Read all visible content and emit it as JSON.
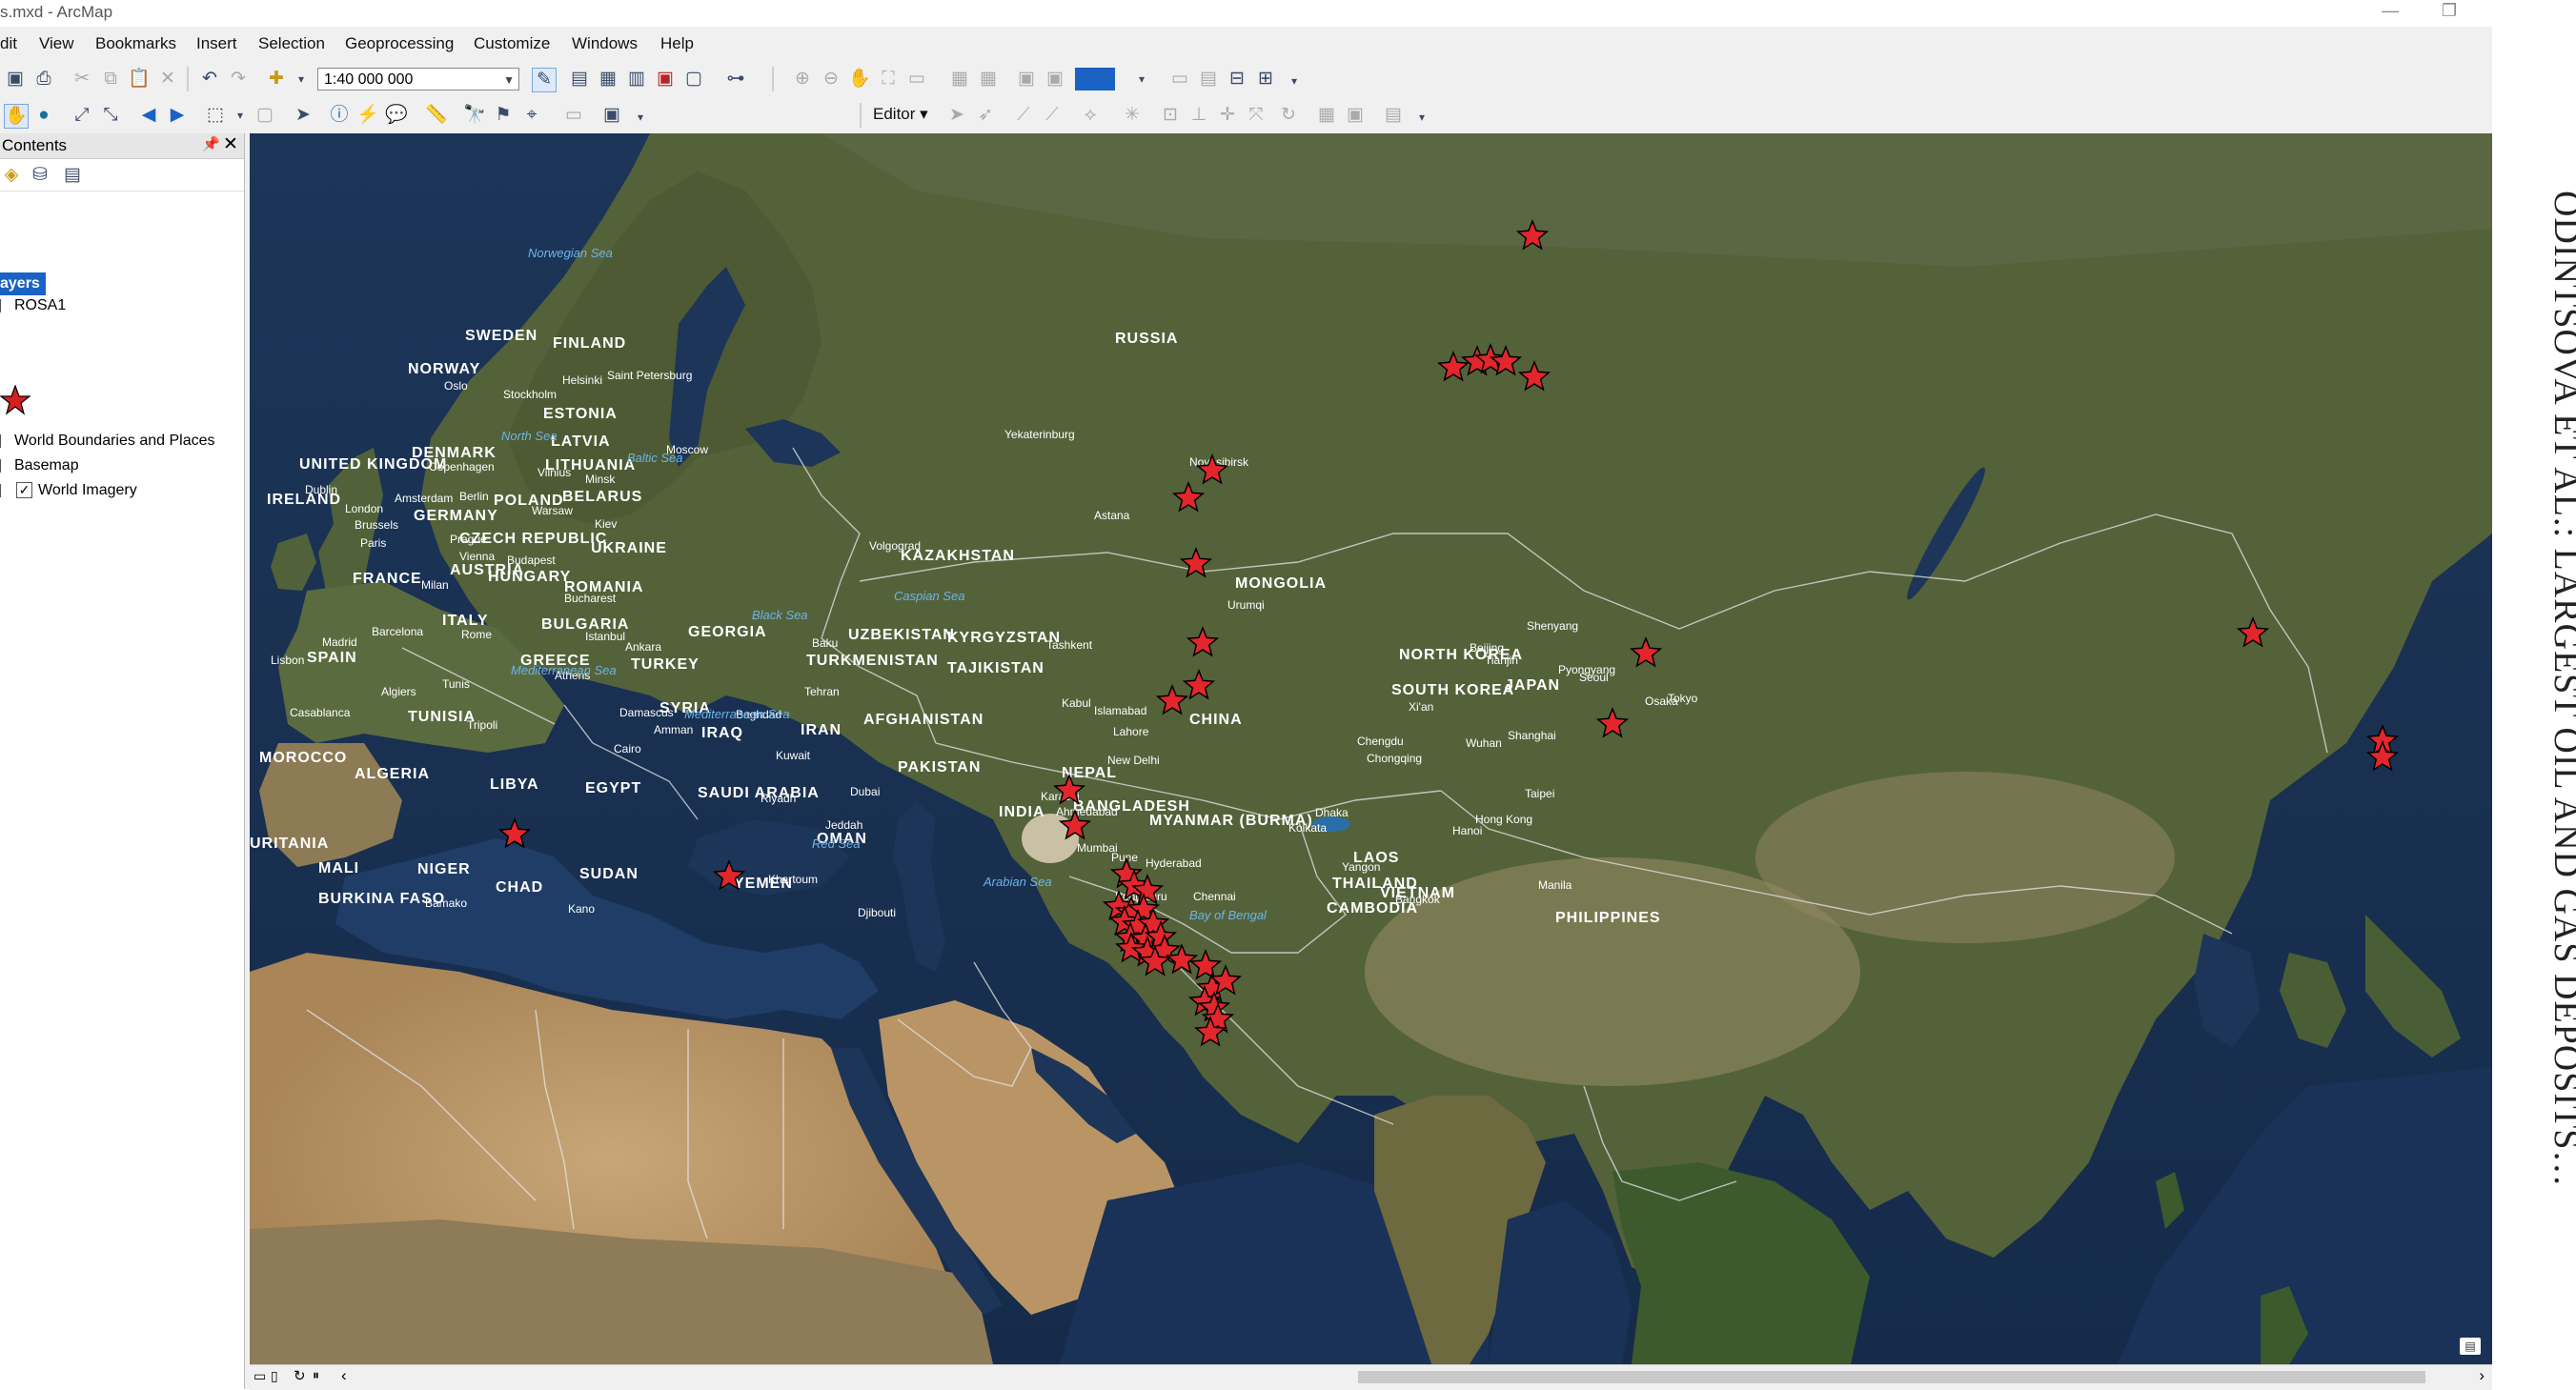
{
  "window": {
    "title": "s.mxd - ArcMap",
    "controls": [
      "minimize-icon",
      "restore-icon"
    ]
  },
  "menu": [
    "dit",
    "View",
    "Bookmarks",
    "Insert",
    "Selection",
    "Geoprocessing",
    "Customize",
    "Windows",
    "Help"
  ],
  "toolbar": {
    "scale_value": "1:40 000 000",
    "editor_label": "Editor"
  },
  "toc": {
    "title": "Contents",
    "root_label": "ayers",
    "layers": [
      {
        "name": "ROSA1",
        "checked": false
      },
      {
        "name": "World Boundaries and Places",
        "checked": false
      },
      {
        "name": "Basemap",
        "checked": false
      },
      {
        "name": "World Imagery",
        "checked": true
      }
    ],
    "symbol_color": "#d81e1e"
  },
  "map": {
    "basemap": "World Imagery",
    "countries": [
      "RUSSIA",
      "SWEDEN",
      "FINLAND",
      "NORWAY",
      "ESTONIA",
      "LATVIA",
      "LITHUANIA",
      "DENMARK",
      "UNITED KINGDOM",
      "IRELAND",
      "POLAND",
      "BELARUS",
      "GERMANY",
      "CZECH REPUBLIC",
      "UKRAINE",
      "FRANCE",
      "AUSTRIA",
      "HUNGARY",
      "ROMANIA",
      "KAZAKHSTAN",
      "MONGOLIA",
      "ITALY",
      "BULGARIA",
      "GEORGIA",
      "SPAIN",
      "GREECE",
      "TURKEY",
      "UZBEKISTAN",
      "KYRGYZSTAN",
      "TURKMENISTAN",
      "TAJIKISTAN",
      "NORTH KOREA",
      "SOUTH KOREA",
      "JAPAN",
      "CHINA",
      "TUNISIA",
      "SYRIA",
      "IRAQ",
      "IRAN",
      "AFGHANISTAN",
      "MOROCCO",
      "ALGERIA",
      "LIBYA",
      "EGYPT",
      "SAUDI ARABIA",
      "PAKISTAN",
      "NEPAL",
      "INDIA",
      "BANGLADESH",
      "MYANMAR (BURMA)",
      "LAOS",
      "THAILAND",
      "VIETNAM",
      "CAMBODIA",
      "PHILIPPINES",
      "OMAN",
      "YEMEN",
      "SUDAN",
      "CHAD",
      "NIGER",
      "MALI",
      "BURKINA FASO",
      "URITANIA"
    ],
    "cities": [
      "Oslo",
      "Stockholm",
      "Helsinki",
      "Saint Petersburg",
      "Moscow",
      "Copenhagen",
      "Dublin",
      "London",
      "Amsterdam",
      "Berlin",
      "Warsaw",
      "Minsk",
      "Vilnius",
      "Brussels",
      "Paris",
      "Prague",
      "Vienna",
      "Budapest",
      "Milan",
      "Kiev",
      "Bucharest",
      "Barcelona",
      "Madrid",
      "Lisbon",
      "Rome",
      "Istanbul",
      "Ankara",
      "Athens",
      "Algiers",
      "Tunis",
      "Tripoli",
      "Casablanca",
      "Cairo",
      "Damascus",
      "Amman",
      "Baghdad",
      "Kuwait",
      "Riyadh",
      "Dubai",
      "Tehran",
      "Baku",
      "Tashkent",
      "Kabul",
      "Islamabad",
      "Karachi",
      "Lahore",
      "New Delhi",
      "Ahmedabad",
      "Mumbai",
      "Pune",
      "Hyderabad",
      "Bengaluru",
      "Chennai",
      "Kolkata",
      "Dhaka",
      "Yangon",
      "Hanoi",
      "Bangkok",
      "Manila",
      "Taipei",
      "Hong Kong",
      "Shanghai",
      "Wuhan",
      "Chengdu",
      "Chongqing",
      "Xi'an",
      "Beijing",
      "Tianjin",
      "Shenyang",
      "Seoul",
      "Pyongyang",
      "Osaka",
      "Tokyo",
      "Yekaterinburg",
      "Novosibirsk",
      "Astana",
      "Volgograd",
      "Urumqi",
      "Jeddah",
      "Khartoum",
      "Djibouti",
      "Bamako",
      "Kano"
    ],
    "water": [
      "Norwegian Sea",
      "North Sea",
      "Baltic Sea",
      "Black Sea",
      "Caspian Sea",
      "Mediterranean Sea",
      "Mediterranean Sea",
      "Red Sea",
      "Arabian Sea",
      "Bay of Bengal"
    ],
    "marker_color": "#e3262b",
    "marker_count": 45
  }
}
